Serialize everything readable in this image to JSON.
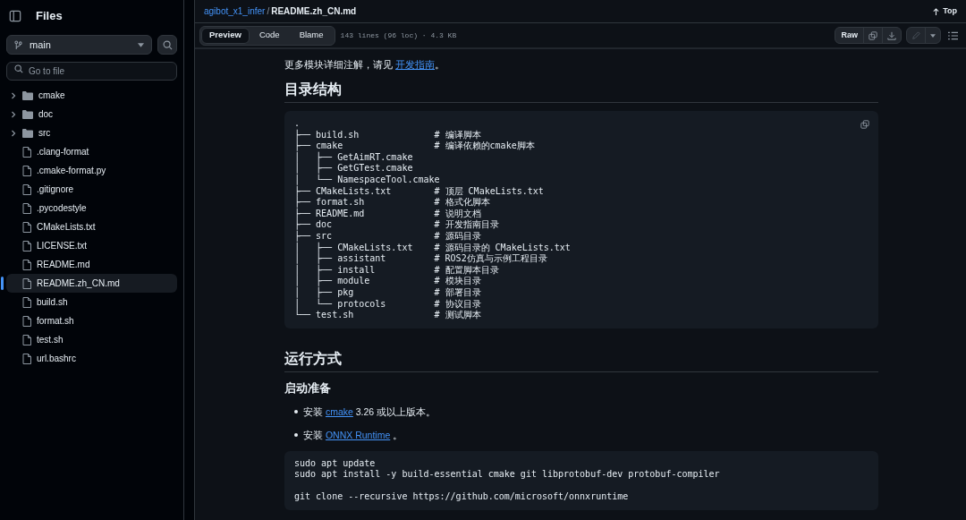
{
  "sidebar": {
    "title": "Files",
    "branch": "main",
    "search": {
      "placeholder": "Go to file"
    },
    "items": [
      {
        "kind": "folder",
        "label": "cmake",
        "expanded": false,
        "selected": false
      },
      {
        "kind": "folder",
        "label": "doc",
        "expanded": false,
        "selected": false
      },
      {
        "kind": "folder",
        "label": "src",
        "expanded": false,
        "selected": false
      },
      {
        "kind": "file",
        "label": ".clang-format",
        "selected": false
      },
      {
        "kind": "file",
        "label": ".cmake-format.py",
        "selected": false
      },
      {
        "kind": "file",
        "label": ".gitignore",
        "selected": false
      },
      {
        "kind": "file",
        "label": ".pycodestyle",
        "selected": false
      },
      {
        "kind": "file",
        "label": "CMakeLists.txt",
        "selected": false
      },
      {
        "kind": "file",
        "label": "LICENSE.txt",
        "selected": false
      },
      {
        "kind": "file",
        "label": "README.md",
        "selected": false
      },
      {
        "kind": "file",
        "label": "README.zh_CN.md",
        "selected": true
      },
      {
        "kind": "file",
        "label": "build.sh",
        "selected": false
      },
      {
        "kind": "file",
        "label": "format.sh",
        "selected": false
      },
      {
        "kind": "file",
        "label": "test.sh",
        "selected": false
      },
      {
        "kind": "file",
        "label": "url.bashrc",
        "selected": false
      }
    ]
  },
  "breadcrumb": {
    "repo": "agibot_x1_infer",
    "separator": "/",
    "file": "README.zh_CN.md"
  },
  "top_link": "Top",
  "tabs": [
    {
      "label": "Preview",
      "selected": true
    },
    {
      "label": "Code",
      "selected": false
    },
    {
      "label": "Blame",
      "selected": false
    }
  ],
  "file_info": "143 lines (96 loc) · 4.3 KB",
  "raw_button": "Raw",
  "content": [
    {
      "kind": "paragraph",
      "parts": [
        {
          "text": "更多模块详细注解，请见 "
        },
        {
          "text": "开发指南",
          "link": true
        },
        {
          "text": "。"
        }
      ]
    },
    {
      "kind": "h2",
      "text": "目录结构"
    },
    {
      "kind": "code",
      "copy": true,
      "groups": [
        [
          ".",
          "├── build.sh              # 编译脚本",
          "├── cmake                 # 编译依赖的cmake脚本",
          "│   ├── GetAimRT.cmake",
          "│   ├── GetGTest.cmake",
          "│   └── NamespaceTool.cmake",
          "├── CMakeLists.txt        # 顶层 CMakeLists.txt",
          "├── format.sh             # 格式化脚本",
          "├── README.md             # 说明文档",
          "├── doc                   # 开发指南目录",
          "├── src                   # 源码目录",
          "│   ├── CMakeLists.txt    # 源码目录的 CMakeLists.txt",
          "│   ├── assistant         # ROS2仿真与示例工程目录",
          "│   ├── install           # 配置脚本目录",
          "│   ├── module            # 模块目录",
          "│   ├── pkg               # 部署目录",
          "│   └── protocols         # 协议目录",
          "└── test.sh               # 测试脚本"
        ]
      ]
    },
    {
      "kind": "h2",
      "text": "运行方式"
    },
    {
      "kind": "h3",
      "text": "启动准备"
    },
    {
      "kind": "bullet",
      "parts": [
        {
          "text": "安装 "
        },
        {
          "text": "cmake",
          "link": true
        },
        {
          "text": " 3.26 或以上版本。"
        }
      ]
    },
    {
      "kind": "bullet",
      "parts": [
        {
          "text": "安装 "
        },
        {
          "text": "ONNX Runtime",
          "link": true
        },
        {
          "text": " 。"
        }
      ]
    },
    {
      "kind": "code",
      "groups": [
        [
          "sudo apt update",
          "sudo apt install -y build-essential cmake git libprotobuf-dev protobuf-compiler"
        ],
        [
          "git clone --recursive https://github.com/microsoft/onnxruntime"
        ]
      ]
    }
  ]
}
